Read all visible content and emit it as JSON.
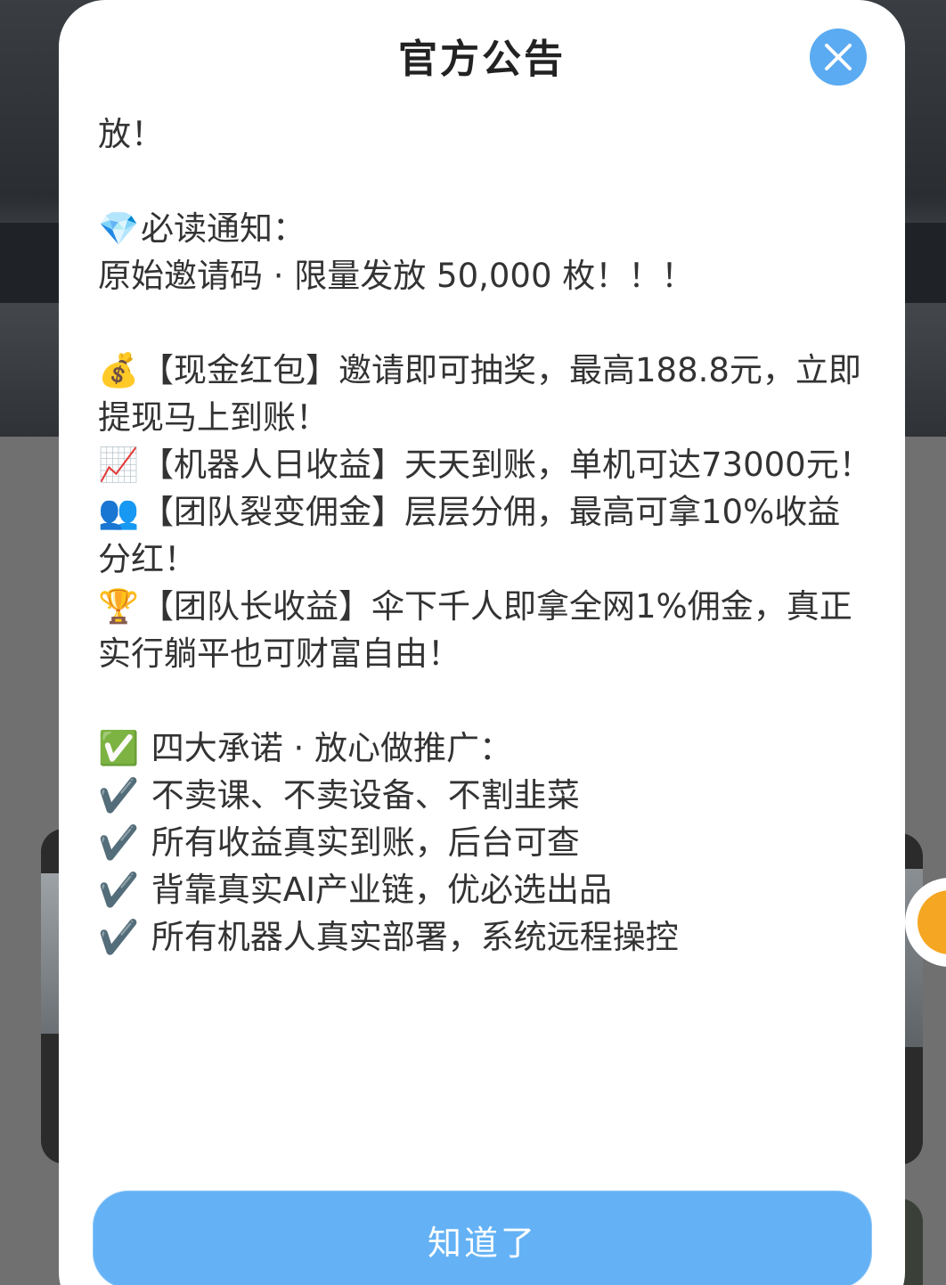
{
  "modal": {
    "title": "官方公告",
    "ok_label": "知道了"
  },
  "content": {
    "intro_fragment": "放！",
    "notice_heading": "必读通知：",
    "notice_line": "原始邀请码 · 限量发放 50,000 枚！！！",
    "benefits": [
      {
        "icon": "money-bag-icon",
        "emoji": "💰",
        "text": "【现金红包】邀请即可抽奖，最高188.8元，立即提现马上到账！"
      },
      {
        "icon": "chart-up-icon",
        "emoji": "📈",
        "text": "【机器人日收益】天天到账，单机可达73000元！"
      },
      {
        "icon": "people-icon",
        "emoji": "👥",
        "text": "【团队裂变佣金】层层分佣，最高可拿10%收益分红！"
      },
      {
        "icon": "trophy-icon",
        "emoji": "🏆",
        "text": "【团队长收益】伞下千人即拿全网1%佣金，真正实行躺平也可财富自由！"
      }
    ],
    "promise_heading": "四大承诺 · 放心做推广：",
    "promises": [
      "不卖课、不卖设备、不割韭菜",
      "所有收益真实到账，后台可查",
      "背靠真实AI产业链，优必选出品",
      "所有机器人真实部署，系统远程操控"
    ]
  },
  "colors": {
    "accent": "#5aabf2",
    "button": "#64b2f5",
    "text": "#333333"
  }
}
